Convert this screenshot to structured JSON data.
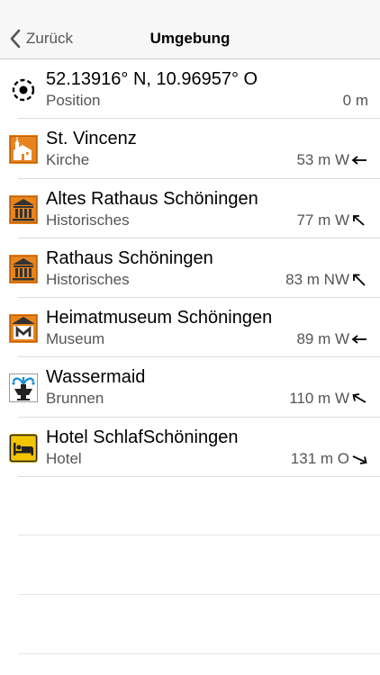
{
  "navbar": {
    "back_label": "Zurück",
    "title": "Umgebung"
  },
  "position": {
    "coords": "52.13916° N, 10.96957° O",
    "label": "Position",
    "distance": "0 m"
  },
  "places": [
    {
      "name": "St. Vincenz",
      "category": "Kirche",
      "distance": "53 m W",
      "icon": "church-icon",
      "arrow": "arrow-left-icon"
    },
    {
      "name": "Altes Rathaus Schöningen",
      "category": "Historisches",
      "distance": "77 m W",
      "icon": "historic-building-icon",
      "arrow": "arrow-up-left-icon"
    },
    {
      "name": "Rathaus Schöningen",
      "category": "Historisches",
      "distance": "83 m NW",
      "icon": "historic-building-icon",
      "arrow": "arrow-up-left-icon"
    },
    {
      "name": "Heimatmuseum Schöningen",
      "category": "Museum",
      "distance": "89 m W",
      "icon": "museum-icon",
      "arrow": "arrow-left-icon"
    },
    {
      "name": "Wassermaid",
      "category": "Brunnen",
      "distance": "110 m W",
      "icon": "fountain-icon",
      "arrow": "arrow-up-left-icon"
    },
    {
      "name": "Hotel SchlafSchöningen",
      "category": "Hotel",
      "distance": "131 m O",
      "icon": "hotel-bed-icon",
      "arrow": "arrow-down-right-icon"
    }
  ],
  "colors": {
    "poi_orange": "#e8841c",
    "hotel_yellow": "#f2c500",
    "text_secondary": "#555555"
  }
}
